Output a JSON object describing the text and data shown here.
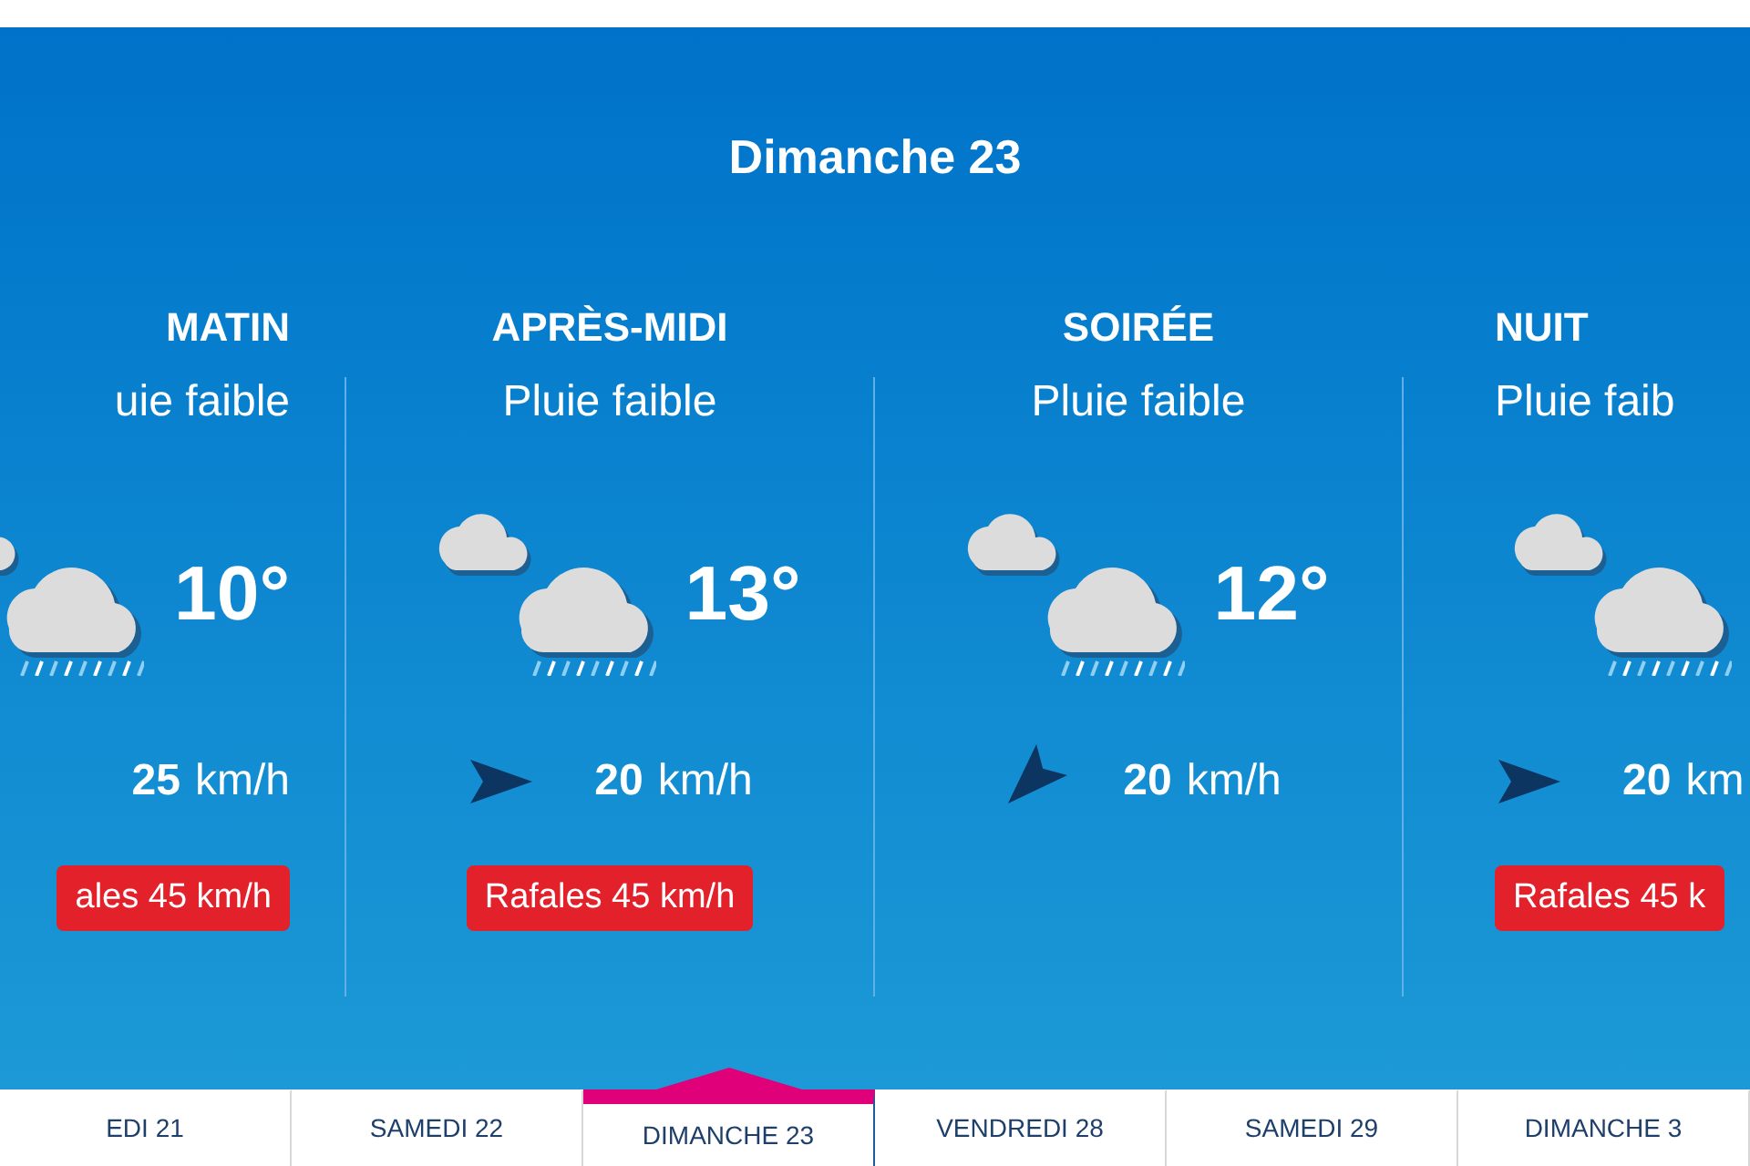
{
  "day_title": "Dimanche 23",
  "periods": [
    {
      "name": "MATIN",
      "condition": "uie faible",
      "temperature": "10°",
      "wind": {
        "kind": "hidden",
        "speed": "25",
        "unit": "km/h"
      },
      "gusts": "ales 45 km/h"
    },
    {
      "name": "APRÈS-MIDI",
      "condition": "Pluie faible",
      "temperature": "13°",
      "wind": {
        "kind": "east",
        "speed": "20",
        "unit": "km/h"
      },
      "gusts": "Rafales 45 km/h"
    },
    {
      "name": "SOIRÉE",
      "condition": "Pluie faible",
      "temperature": "12°",
      "wind": {
        "kind": "southwest",
        "speed": "20",
        "unit": "km/h"
      }
    },
    {
      "name": "NUIT",
      "condition": "Pluie faib",
      "wind": {
        "kind": "east",
        "speed": "20",
        "unit": "km"
      },
      "gusts": "Rafales 45 k"
    }
  ],
  "day_tabs": [
    {
      "label": "EDI 21",
      "selected": false
    },
    {
      "label": "SAMEDI 22",
      "selected": false
    },
    {
      "label": "DIMANCHE 23",
      "selected": true
    },
    {
      "label": "VENDREDI 28",
      "selected": false
    },
    {
      "label": "SAMEDI 29",
      "selected": false
    },
    {
      "label": "DIMANCHE 3",
      "selected": false
    }
  ]
}
